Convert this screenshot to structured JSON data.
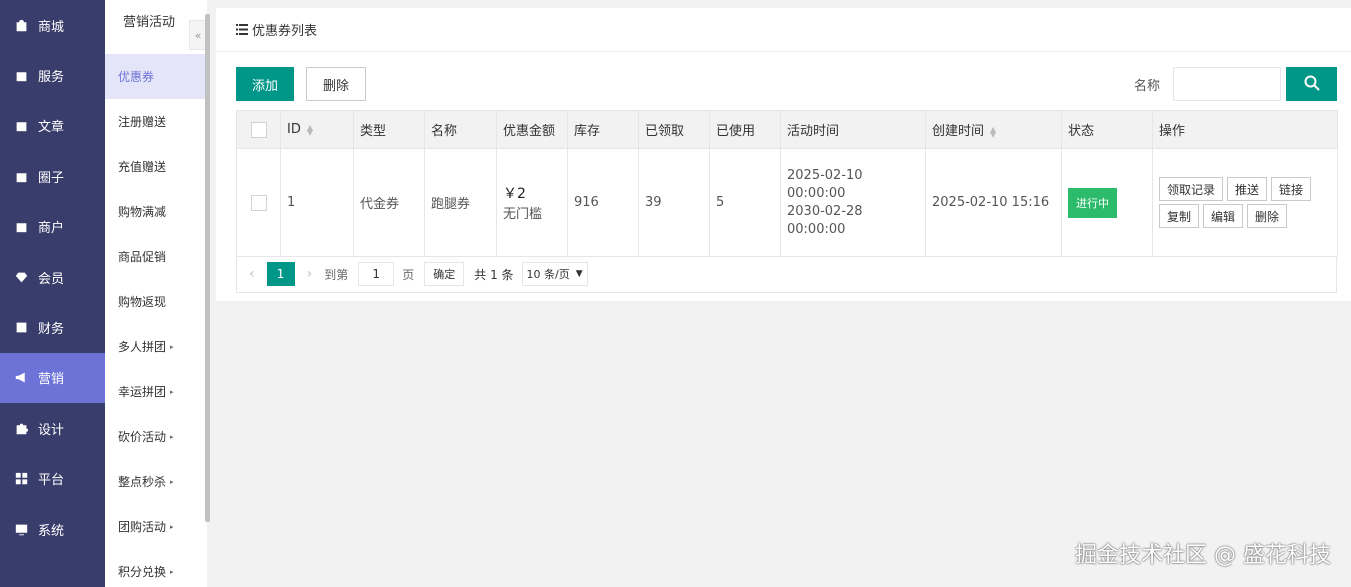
{
  "nav": {
    "items": [
      {
        "label": "商城",
        "icon": "bag-icon"
      },
      {
        "label": "服务",
        "icon": "bag-icon"
      },
      {
        "label": "文章",
        "icon": "bag-icon"
      },
      {
        "label": "圈子",
        "icon": "bag-icon"
      },
      {
        "label": "商户",
        "icon": "bag-icon"
      },
      {
        "label": "会员",
        "icon": "diamond-icon"
      },
      {
        "label": "财务",
        "icon": "finance-icon"
      },
      {
        "label": "营销",
        "icon": "megaphone-icon",
        "active": true
      },
      {
        "label": "设计",
        "icon": "puzzle-icon"
      },
      {
        "label": "平台",
        "icon": "grid-icon"
      },
      {
        "label": "系统",
        "icon": "monitor-icon"
      }
    ]
  },
  "subnav": {
    "title": "营销活动",
    "collapse_glyph": "«",
    "items": [
      {
        "label": "优惠券",
        "active": true
      },
      {
        "label": "注册赠送"
      },
      {
        "label": "充值赠送"
      },
      {
        "label": "购物满减"
      },
      {
        "label": "商品促销"
      },
      {
        "label": "购物返现"
      },
      {
        "label": "多人拼团",
        "arrow": "▸"
      },
      {
        "label": "幸运拼团",
        "arrow": "▸"
      },
      {
        "label": "砍价活动",
        "arrow": "▸"
      },
      {
        "label": "整点秒杀",
        "arrow": "▸"
      },
      {
        "label": "团购活动",
        "arrow": "▸"
      },
      {
        "label": "积分兑换",
        "arrow": "▸"
      }
    ]
  },
  "card": {
    "title": "优惠券列表",
    "add_label": "添加",
    "delete_label": "删除",
    "search_label": "名称",
    "search_value": ""
  },
  "table": {
    "headers": [
      "ID",
      "类型",
      "名称",
      "优惠金额",
      "库存",
      "已领取",
      "已使用",
      "活动时间",
      "创建时间",
      "状态",
      "操作"
    ],
    "rows": [
      {
        "id": "1",
        "type": "代金券",
        "name": "跑腿券",
        "amount": "￥2",
        "threshold": "无门槛",
        "stock": "916",
        "received": "39",
        "used": "5",
        "start_time": "2025-02-10 00:00:00",
        "end_time": "2030-02-28 00:00:00",
        "created": "2025-02-10 15:16",
        "status": "进行中",
        "status_color": "#2cbb6b",
        "ops": [
          "领取记录",
          "推送",
          "链接",
          "复制",
          "编辑",
          "删除"
        ]
      }
    ]
  },
  "pager": {
    "prev": "‹",
    "current": "1",
    "next": "›",
    "goto_label": "到第",
    "goto_value": "1",
    "page_unit": "页",
    "confirm_label": "确定",
    "total": "共 1 条",
    "page_size": "10 条/页"
  },
  "watermark": "掘金技术社区 @ 盛花科技",
  "colors": {
    "accent": "#009688",
    "nav_bg": "#393d6b",
    "nav_active": "#6d73d6"
  }
}
